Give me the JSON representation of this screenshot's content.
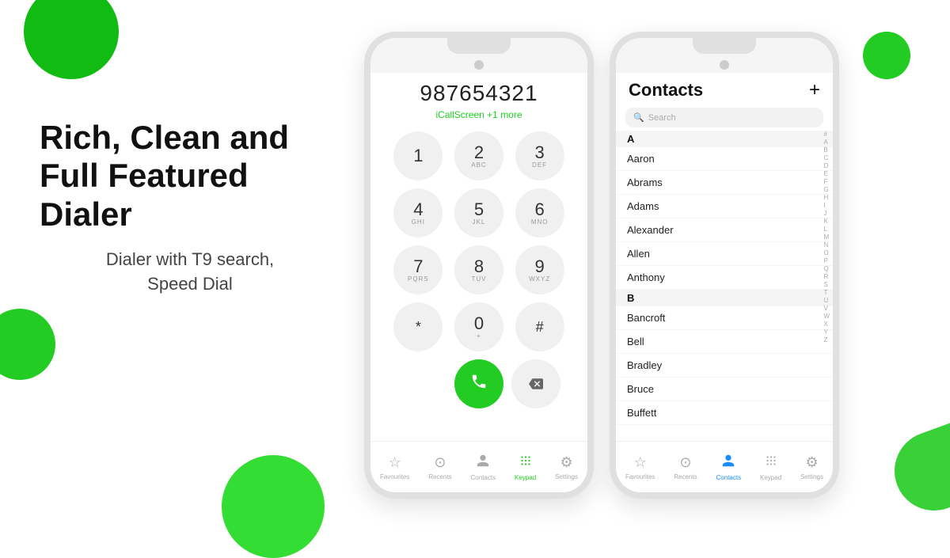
{
  "hero": {
    "title_line1": "Rich, Clean and",
    "title_line2": "Full Featured Dialer",
    "subtitle_line1": "Dialer with T9 search,",
    "subtitle_line2": "Speed Dial"
  },
  "dialer_phone": {
    "number": "987654321",
    "caller_name": "iCallScreen",
    "caller_more": "+1 more",
    "keys": [
      {
        "num": "1",
        "letters": ""
      },
      {
        "num": "2",
        "letters": "ABC"
      },
      {
        "num": "3",
        "letters": "DEF"
      },
      {
        "num": "4",
        "letters": "GHI"
      },
      {
        "num": "5",
        "letters": "JKL"
      },
      {
        "num": "6",
        "letters": "MNO"
      },
      {
        "num": "7",
        "letters": "PQRS"
      },
      {
        "num": "8",
        "letters": "TUV"
      },
      {
        "num": "9",
        "letters": "WXYZ"
      },
      {
        "num": "*",
        "letters": ""
      },
      {
        "num": "0",
        "letters": "+"
      },
      {
        "num": "#",
        "letters": ""
      }
    ],
    "nav": [
      {
        "label": "Favourites",
        "icon": "★",
        "active": false
      },
      {
        "label": "Recents",
        "icon": "⏱",
        "active": false
      },
      {
        "label": "Contacts",
        "icon": "👤",
        "active": false
      },
      {
        "label": "Keypad",
        "icon": "⌨",
        "active": true
      },
      {
        "label": "Settings",
        "icon": "⚙",
        "active": false
      }
    ]
  },
  "contacts_phone": {
    "title": "Contacts",
    "add_btn": "+",
    "search_placeholder": "Search",
    "groups": [
      {
        "letter": "A",
        "contacts": [
          "Aaron",
          "Abrams",
          "Adams",
          "Alexander",
          "Allen",
          "Anthony"
        ]
      },
      {
        "letter": "B",
        "contacts": [
          "Bancroft",
          "Bell",
          "Bradley",
          "Bruce",
          "Buffett"
        ]
      }
    ],
    "alphabet": [
      "#",
      "A",
      "B",
      "C",
      "D",
      "E",
      "F",
      "G",
      "H",
      "I",
      "J",
      "K",
      "L",
      "M",
      "N",
      "O",
      "P",
      "Q",
      "R",
      "S",
      "T",
      "U",
      "V",
      "W",
      "X",
      "Y",
      "Z"
    ],
    "nav": [
      {
        "label": "Favourites",
        "icon": "★",
        "active": false
      },
      {
        "label": "Recents",
        "icon": "⏱",
        "active": false
      },
      {
        "label": "Contacts",
        "icon": "👤",
        "active": true
      },
      {
        "label": "Keypad",
        "icon": "⌨",
        "active": false
      },
      {
        "label": "Settings",
        "icon": "⚙",
        "active": false
      }
    ]
  }
}
